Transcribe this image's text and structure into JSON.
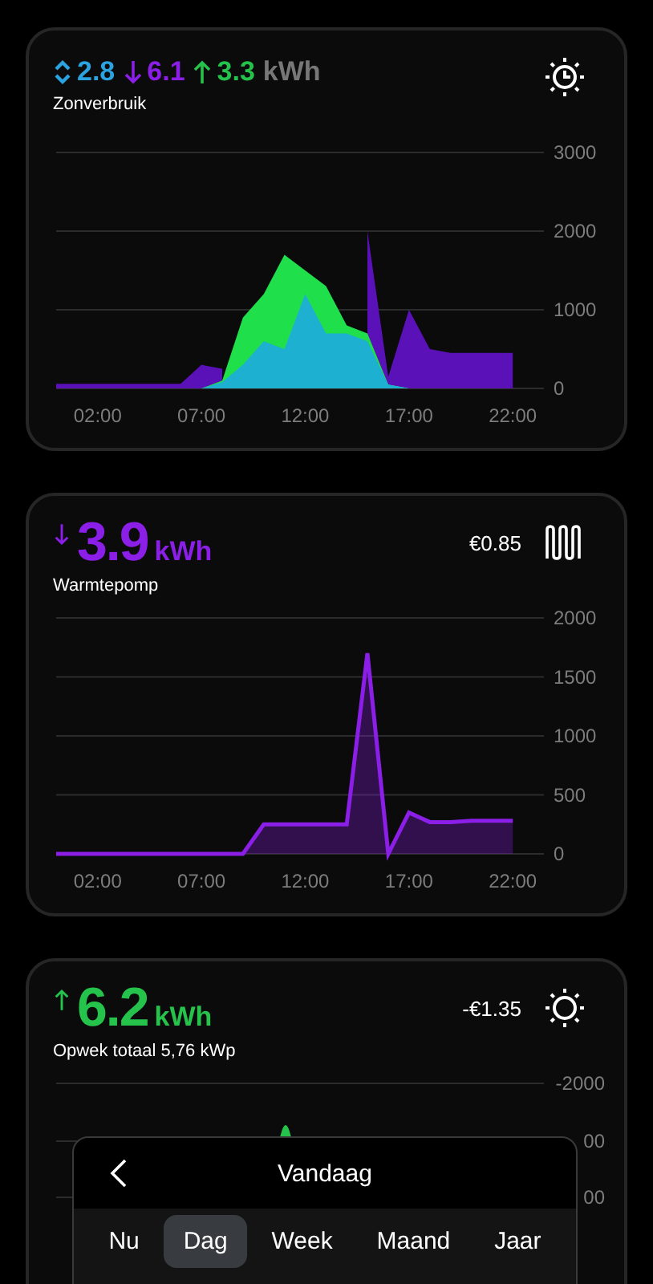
{
  "cards": [
    {
      "kind": "solar-usage",
      "totals": [
        {
          "kind": "both",
          "value": "2.8",
          "color": "#2aa3e0"
        },
        {
          "kind": "down",
          "value": "6.1",
          "color": "#8b1fe8"
        },
        {
          "kind": "up",
          "value": "3.3",
          "color": "#25c24c"
        }
      ],
      "unit": "kWh",
      "title": "Zonverbruik",
      "chart_data": {
        "type": "area",
        "x": [
          0,
          1,
          2,
          3,
          4,
          5,
          6,
          7,
          8,
          9,
          10,
          11,
          12,
          13,
          14,
          15,
          16,
          17,
          18,
          19,
          20,
          21,
          22
        ],
        "xticks": [
          {
            "value": 2,
            "label": "02:00"
          },
          {
            "value": 7,
            "label": "07:00"
          },
          {
            "value": 12,
            "label": "12:00"
          },
          {
            "value": 17,
            "label": "17:00"
          },
          {
            "value": 22,
            "label": "22:00"
          }
        ],
        "xlim": [
          0,
          23.5
        ],
        "ylim": [
          0,
          3000
        ],
        "yticks": [
          0,
          1000,
          2000,
          3000
        ],
        "grid": true,
        "series": [
          {
            "color": "#5a12b8",
            "values": [
              60,
              60,
              60,
              60,
              60,
              60,
              60,
              300,
              250,
              null,
              null,
              null,
              null,
              null,
              null,
              2000,
              150,
              1000,
              500,
              450,
              450,
              450,
              450
            ]
          },
          {
            "color": "#1fe04a",
            "values": [
              0,
              0,
              0,
              0,
              0,
              0,
              0,
              0,
              100,
              900,
              1200,
              1700,
              1500,
              1300,
              800,
              700,
              50,
              0,
              0,
              0,
              0,
              0,
              0
            ]
          },
          {
            "color": "#1eb0d0",
            "values": [
              0,
              0,
              0,
              0,
              0,
              0,
              0,
              0,
              80,
              300,
              600,
              500,
              1200,
              700,
              700,
              600,
              50,
              0,
              0,
              0,
              0,
              0,
              0
            ]
          }
        ]
      }
    },
    {
      "kind": "heat-pump",
      "headline": {
        "kind": "down",
        "value": "3.9",
        "unit": "kWh",
        "color": "#8b1fe8"
      },
      "title": "Warmtepomp",
      "cost": "€0.85",
      "chart_data": {
        "type": "area",
        "x": [
          0,
          1,
          2,
          3,
          4,
          5,
          6,
          7,
          8,
          9,
          10,
          11,
          12,
          13,
          14,
          15,
          16,
          17,
          18,
          19,
          20,
          21,
          22
        ],
        "xticks": [
          {
            "value": 2,
            "label": "02:00"
          },
          {
            "value": 7,
            "label": "07:00"
          },
          {
            "value": 12,
            "label": "12:00"
          },
          {
            "value": 17,
            "label": "17:00"
          },
          {
            "value": 22,
            "label": "22:00"
          }
        ],
        "xlim": [
          0,
          23.5
        ],
        "ylim": [
          0,
          2000
        ],
        "yticks": [
          0,
          500,
          1000,
          1500,
          2000
        ],
        "grid": true,
        "series": [
          {
            "color": "#8b1fe8",
            "values": [
              0,
              0,
              0,
              0,
              0,
              0,
              0,
              0,
              0,
              0,
              250,
              250,
              250,
              250,
              250,
              1700,
              0,
              350,
              270,
              270,
              280,
              280,
              280
            ]
          }
        ]
      }
    },
    {
      "kind": "generation",
      "headline": {
        "kind": "up",
        "value": "6.2",
        "unit": "kWh",
        "color": "#25c24c"
      },
      "title": "Opwek totaal 5,76 kWp",
      "cost": "-€1.35",
      "axis_labels": [
        "-2000",
        "00",
        "00"
      ]
    }
  ],
  "period_picker": {
    "title": "Vandaag",
    "tabs": [
      {
        "label": "Nu",
        "selected": false
      },
      {
        "label": "Dag",
        "selected": true
      },
      {
        "label": "Week",
        "selected": false
      },
      {
        "label": "Maand",
        "selected": false
      },
      {
        "label": "Jaar",
        "selected": false
      }
    ]
  }
}
